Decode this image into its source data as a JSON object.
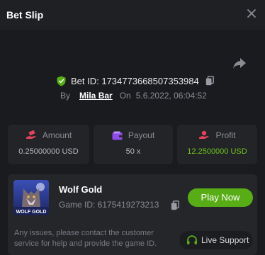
{
  "header": {
    "title": "Bet Slip"
  },
  "bet": {
    "id_text": "Bet ID: 1734773668507353984",
    "by_label": "By",
    "user": "Mila Bar",
    "on_label": "On",
    "datetime": "5.6.2022, 06:04:52"
  },
  "stats": [
    {
      "label": "Amount",
      "value": "0.25000000 USD"
    },
    {
      "label": "Payout",
      "value": "50 x"
    },
    {
      "label": "Profit",
      "value": "12.2500000 USD"
    }
  ],
  "game": {
    "name": "Wolf Gold",
    "id_text": "Game ID: 6175419273213",
    "play_label": "Play Now",
    "thumb_caption": "WOLF GOLD"
  },
  "support": {
    "text": "Any issues, please contact the customer service for help and provide the game ID.",
    "button_label": "Live Support"
  },
  "colors": {
    "background": "#1a1b1f",
    "card": "#232428",
    "accent_green": "#58ad17",
    "profit_green": "#6fc61d",
    "muted": "#8b8c94"
  },
  "icons": [
    "close-icon",
    "share-icon",
    "shield-check-icon",
    "copy-icon",
    "money-hand-icon",
    "wallet-icon",
    "profit-hand-icon",
    "headset-icon"
  ]
}
